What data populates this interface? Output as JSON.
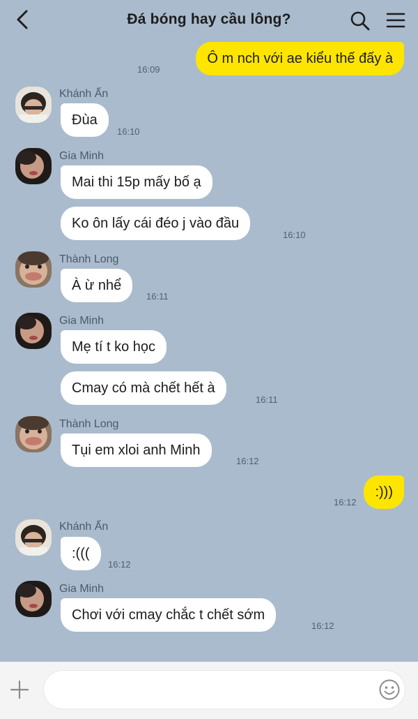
{
  "header": {
    "title": "Đá bóng hay cầu lông?"
  },
  "messages": [
    {
      "text": "Ô m nch với ae kiểu thế đấy à",
      "time": "16:09"
    },
    {
      "sender": "Khánh Ấn",
      "text": "Đùa",
      "time": "16:10"
    },
    {
      "sender": "Gia Minh",
      "text": "Mai thi 15p mấy bố ạ"
    },
    {
      "text": "Ko ôn lấy cái đéo j vào đầu",
      "time": "16:10"
    },
    {
      "sender": "Thành Long",
      "text": "À ừ nhể",
      "time": "16:11"
    },
    {
      "sender": "Gia Minh",
      "text": "Mẹ tí t ko học"
    },
    {
      "text": "Cmay có mà chết hết à",
      "time": "16:11"
    },
    {
      "sender": "Thành Long",
      "text": "Tụi em xloi anh Minh",
      "time": "16:12"
    },
    {
      "text": ":)))",
      "time": "16:12"
    },
    {
      "sender": "Khánh Ấn",
      "text": ":(((",
      "time": "16:12"
    },
    {
      "sender": "Gia Minh",
      "text": "Chơi với cmay chắc t chết sớm",
      "time": "16:12"
    }
  ],
  "composer": {
    "placeholder": ""
  },
  "colors": {
    "background": "#a9bbcd",
    "outgoing_bubble": "#fee500",
    "incoming_bubble": "#ffffff"
  },
  "icons": [
    "back-icon",
    "search-icon",
    "menu-icon",
    "plus-icon",
    "emoji-icon"
  ]
}
